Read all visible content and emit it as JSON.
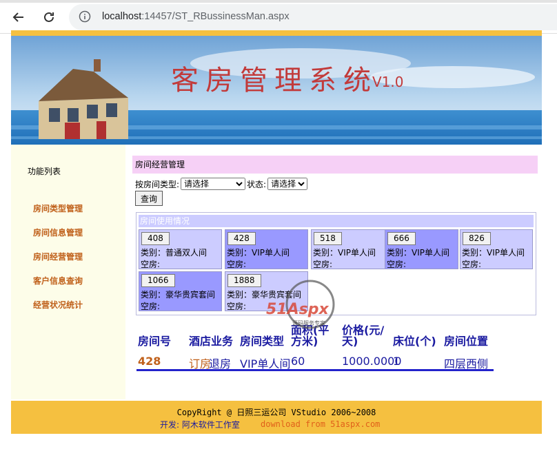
{
  "browser": {
    "url_host": "localhost",
    "url_path": ":14457/ST_RBussinessMan.aspx"
  },
  "banner": {
    "title": "客房管理系统",
    "version": "V1.0"
  },
  "sidebar": {
    "title": "功能列表",
    "items": [
      {
        "label": "房间类型管理"
      },
      {
        "label": "房间信息管理"
      },
      {
        "label": "房间经营管理"
      },
      {
        "label": "客户信息查询"
      },
      {
        "label": "经营状况统计"
      }
    ]
  },
  "main": {
    "header": "房间经营管理",
    "filter": {
      "type_label": "按房间类型:",
      "type_value": "请选择",
      "status_label": "状态:",
      "status_value": "请选择",
      "query_label": "查询"
    },
    "usage": {
      "caption": "房间使用情况",
      "rooms": [
        {
          "number": "408",
          "type_line": "类别：普通双人间",
          "state_line": "空房:",
          "color": "#ccccff"
        },
        {
          "number": "428",
          "type_line": "类别：VIP单人间",
          "state_line": "空房:",
          "color": "#9999ff"
        },
        {
          "number": "518",
          "type_line": "类别：VIP单人间",
          "state_line": "空房:",
          "color": "#ccccff"
        },
        {
          "number": "666",
          "type_line": "类别：VIP单人间",
          "state_line": "空房:",
          "color": "#9999ff"
        },
        {
          "number": "826",
          "type_line": "类别：VIP单人间",
          "state_line": "空房:",
          "color": "#ccccff"
        },
        {
          "number": "1066",
          "type_line": "类别：豪华贵宾套间",
          "state_line": "空房:",
          "color": "#9999ff"
        },
        {
          "number": "1888",
          "type_line": "类别：豪华贵宾套间",
          "state_line": "空房:",
          "color": "#ccccff"
        }
      ]
    },
    "table": {
      "headers": [
        "房间号",
        "酒店业务",
        "房间类型",
        "面积(平方米)",
        "价格(元/天)",
        "床位(个)",
        "房间位置"
      ],
      "row": {
        "room_no": "428",
        "book": "订房",
        "checkout": "退房",
        "type": "VIP单人间",
        "area": "60",
        "price": "1000.0000",
        "beds": "1",
        "location": "四层西侧"
      }
    }
  },
  "footer": {
    "line1": "CopyRight @ 日照三运公司 VStudio 2006~2008",
    "line2": "开发: 阿木软件工作室",
    "line2_link": "download from 51aspx.com"
  },
  "watermark": {
    "brand": "51Aspx",
    "tagline": "源码服务专家"
  },
  "colors": {
    "gold": "#f5c040",
    "sidebar_bg": "#fdfde9",
    "header_pink": "#f6d0f6",
    "room_light": "#ccccff",
    "room_dark": "#9999ff",
    "link_orange": "#c0601a",
    "text_blue": "#1a1aa0"
  }
}
